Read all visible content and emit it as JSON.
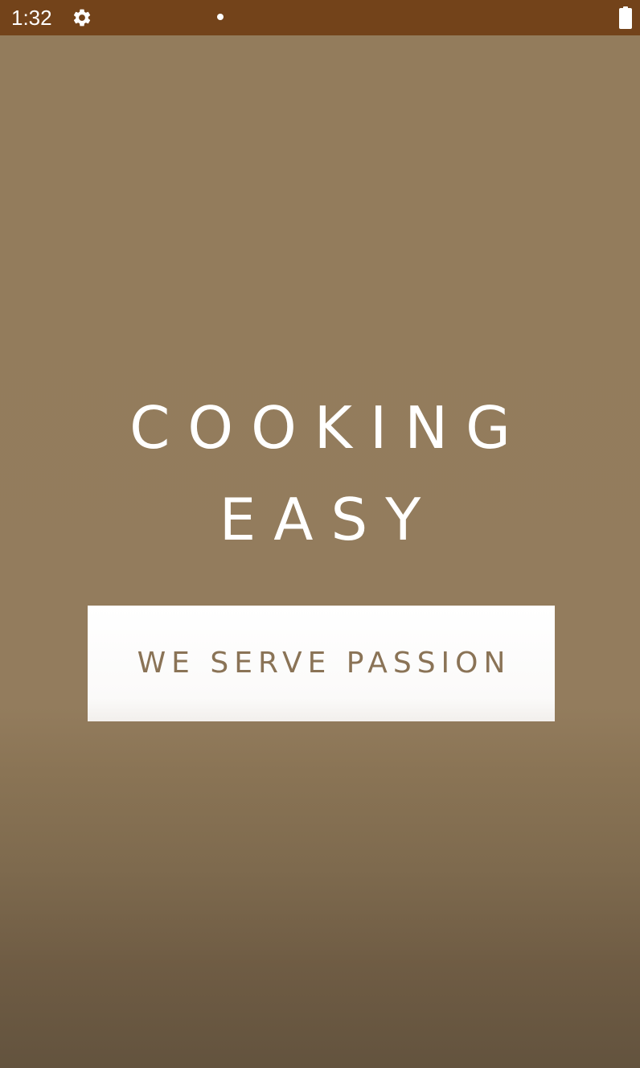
{
  "status_bar": {
    "time": "1:32",
    "icons": [
      "gear-icon",
      "notification-dot-icon",
      "battery-icon"
    ],
    "background_color": "#73431a"
  },
  "splash": {
    "title_line_1": "COOKING",
    "title_line_2": "EASY",
    "tagline": "WE SERVE PASSION",
    "background_color": "#937c5c",
    "tagline_color": "#8a7356"
  }
}
